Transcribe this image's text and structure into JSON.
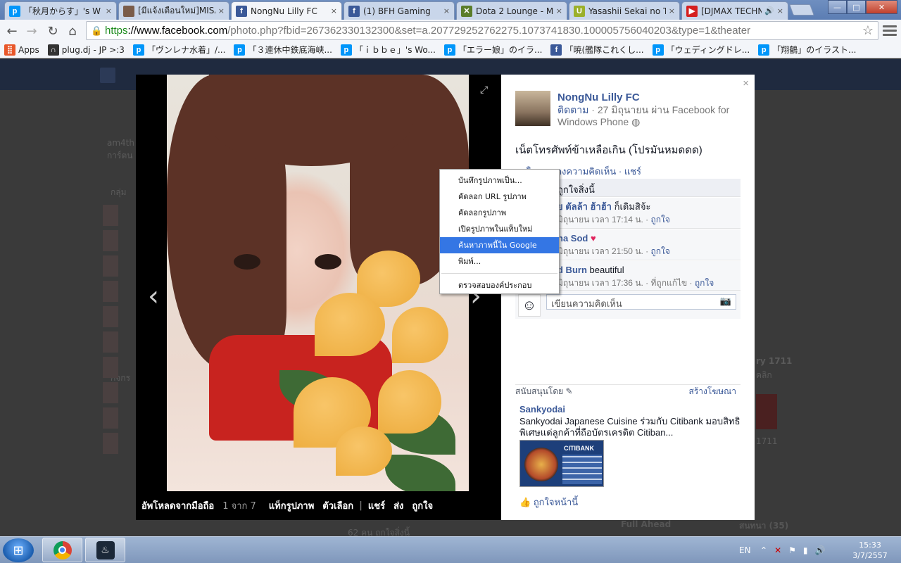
{
  "tabs": [
    {
      "title": "「秋月からす」's W",
      "icon": "pixiv-icon",
      "color": "#0096fa",
      "glyph": "p"
    },
    {
      "title": "[มีแจ้งเตือนใหม่]MISA",
      "icon": "avatar-icon",
      "color": "#7a5c4a",
      "glyph": ""
    },
    {
      "title": "NongNu Lilly FC",
      "icon": "facebook-icon",
      "color": "#3b5998",
      "glyph": "f",
      "active": true
    },
    {
      "title": "(1) BFH Gaming",
      "icon": "facebook-icon",
      "color": "#3b5998",
      "glyph": "f"
    },
    {
      "title": "Dota 2 Lounge - Ma",
      "icon": "dota-lounge-icon",
      "color": "#5b7d2a",
      "glyph": "✕"
    },
    {
      "title": "Yasashii Sekai no Ts",
      "icon": "yasashii-icon",
      "color": "#9bb02a",
      "glyph": "U"
    },
    {
      "title": "[DJMAX TECHNI",
      "icon": "youtube-icon",
      "color": "#d51f1f",
      "glyph": "▶",
      "audio": "🔊"
    }
  ],
  "tab_close": "×",
  "window_controls": {
    "min": "—",
    "max": "□",
    "close": "✕"
  },
  "toolbar": {
    "back": "←",
    "forward": "→",
    "reload": "↻",
    "home": "⌂",
    "url_scheme": "https",
    "url_host": "://www.facebook.com",
    "url_rest": "/photo.php?fbid=267362330132300&set=a.207729252762275.1073741830.100005756040203&type=1&theater",
    "star": "☆"
  },
  "bookmarks": [
    {
      "label": "Apps",
      "icon": "apps-icon",
      "color": "#e8572a",
      "glyph": "⣿"
    },
    {
      "label": "plug.dj - JP >:3",
      "icon": "headphones-icon",
      "color": "#333333",
      "glyph": "∩"
    },
    {
      "label": "「ヴンレナ水着」/...",
      "icon": "pixiv-icon",
      "color": "#0096fa",
      "glyph": "p"
    },
    {
      "label": "「３連休中鉄底海峡...",
      "icon": "pixiv-icon",
      "color": "#0096fa",
      "glyph": "p"
    },
    {
      "label": "「ｉｂｂｅ」's Wo...",
      "icon": "pixiv-icon",
      "color": "#0096fa",
      "glyph": "p"
    },
    {
      "label": "「エラー娘」のイラ...",
      "icon": "pixiv-icon",
      "color": "#0096fa",
      "glyph": "p"
    },
    {
      "label": "「暁(艦隊これくし...",
      "icon": "facebook-icon",
      "color": "#3b5998",
      "glyph": "f"
    },
    {
      "label": "「ウェディングドレ...",
      "icon": "pixiv-icon",
      "color": "#0096fa",
      "glyph": "p"
    },
    {
      "label": "「翔鶴」のイラスト...",
      "icon": "pixiv-icon",
      "color": "#0096fa",
      "glyph": "p"
    }
  ],
  "background": {
    "left_text_1": "am4th",
    "left_text_2": "การ์ตน",
    "left_text_3": "กลุ่ม",
    "left_text_4": "กิจกร",
    "right_text_1": "ry 1711",
    "right_text_2": "คลิก",
    "right_text_3": "1711",
    "right_text_4": "Full Ahead",
    "right_text_5": "สนทนา (35)",
    "bottom_text": "62 คน ถูกใจสิ่งนี้"
  },
  "photo_bar": {
    "uploaded": "อัพโหลดจากมือถือ",
    "count": "1 จาก 7",
    "tag": "แท็กรูปภาพ",
    "options": "ตัวเลือก",
    "share": "แชร์",
    "send": "ส่ง",
    "like": "ถูกใจ"
  },
  "panel": {
    "close": "×",
    "page_name": "NongNu Lilly FC",
    "follow": "ติดตาม",
    "meta": " · 27 มิถุนายน ผ่าน Facebook for Windows Phone",
    "globe": "◍",
    "caption": "เน็ตโทรศัพท์ข้าเหลือเกิน (โปรมันหมดดด)",
    "actions": "ถูกใจ · แสดงความคิดเห็น · แชร์",
    "likes_text": "ถูกใจสิ่งนี้",
    "comments": [
      {
        "author": "ย ตัลล้า ฮ้าฮ้า",
        "text": " ก็เดิมสิจ้ะ",
        "meta": "มิถุนายน เวลา 17:14 น. · ",
        "like": "ถูกใจ"
      },
      {
        "author": "na Sod",
        "text": " ♥",
        "meta": "มิถุนายน เวลา 21:50 น. · ",
        "like": "ถูกใจ"
      },
      {
        "author": "d Burn",
        "text": " beautiful",
        "meta": "มิถุนายน เวลา 17:36 น. · ที่ถูกแก้ไข · ",
        "like": "ถูกใจ"
      }
    ],
    "write_placeholder": "เขียนความคิดเห็น",
    "camera": "📷",
    "sponsored": "สนับสนุนโดย",
    "sponsored_icon": "✎",
    "create_ad": "สร้างโฆษณา",
    "ad_title": "Sankyodai",
    "ad_body": "Sankyodai Japanese Cuisine ร่วมกับ Citibank มอบสิทธิพิเศษแด่ลูกค้าที่ถือบัตรเครดิต Citiban...",
    "ad_brand": "CITIBANK",
    "ad_like": "ถูกใจหน้านี้",
    "ad_like_icon": "👍"
  },
  "context_menu": {
    "items": [
      "บันทึกรูปภาพเป็น...",
      "คัดลอก URL รูปภาพ",
      "คัดลอกรูปภาพ",
      "เปิดรูปภาพในแท็บใหม่",
      "ค้นหาภาพนี้ใน Google",
      "พิมพ์..."
    ],
    "highlighted_index": 4,
    "inspect": "ตรวจสอบองค์ประกอบ"
  },
  "taskbar": {
    "start": "⊞",
    "steam_glyph": "♨",
    "lang": "EN",
    "time": "15:33",
    "date": "3/7/2557",
    "tray_icons": [
      "⌃",
      "✕",
      "⚑",
      "▮",
      "🔊"
    ]
  }
}
